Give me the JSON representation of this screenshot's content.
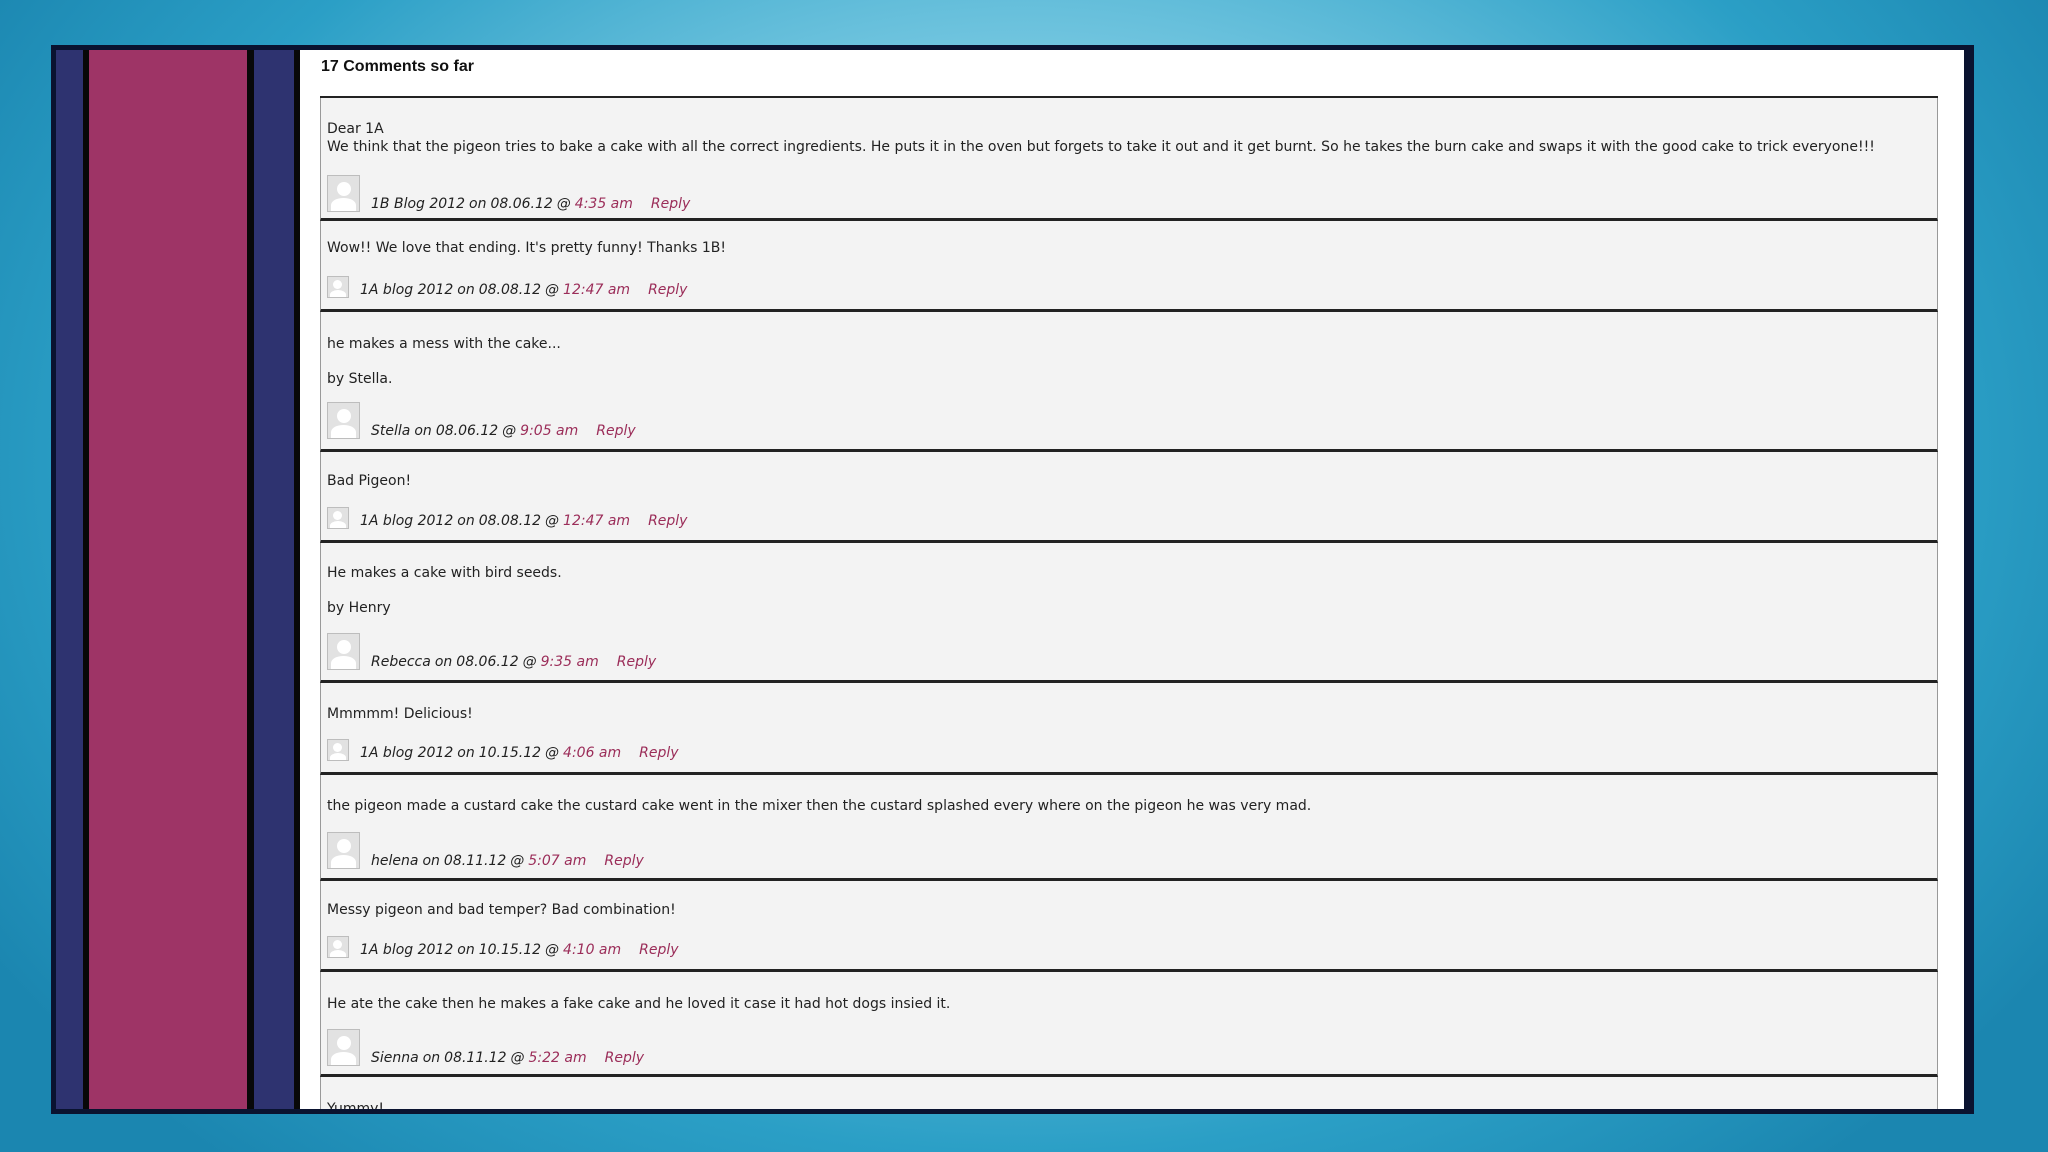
{
  "heading": "17 Comments so far",
  "reply_label": "Reply",
  "comments": [
    {
      "lines": [
        "Dear 1A",
        "We think that the pigeon tries to bake a cake with all the correct ingredients. He puts it in the oven but forgets to take it out and it get burnt. So he takes the burn cake and swaps it with the good cake to trick everyone!!!"
      ],
      "author": "1B Blog 2012",
      "date": "08.06.12",
      "time": "4:35 am"
    },
    {
      "lines": [
        "Wow!! We love that ending. It's pretty funny! Thanks 1B!"
      ],
      "author": "1A blog 2012",
      "date": "08.08.12",
      "time": "12:47 am"
    },
    {
      "lines": [
        "he makes a mess with the cake...",
        "by Stella."
      ],
      "author": "Stella",
      "date": "08.06.12",
      "time": "9:05 am"
    },
    {
      "lines": [
        "Bad Pigeon!"
      ],
      "author": "1A blog 2012",
      "date": "08.08.12",
      "time": "12:47 am"
    },
    {
      "lines": [
        "He makes a cake with bird seeds.",
        "by Henry"
      ],
      "author": "Rebecca",
      "date": "08.06.12",
      "time": "9:35 am"
    },
    {
      "lines": [
        "Mmmmm! Delicious!"
      ],
      "author": "1A blog 2012",
      "date": "10.15.12",
      "time": "4:06 am"
    },
    {
      "lines": [
        "the pigeon made a custard cake the custard cake went in the mixer then the custard splashed every where on the pigeon he was very mad."
      ],
      "author": "helena",
      "date": "08.11.12",
      "time": "5:07 am"
    },
    {
      "lines": [
        "Messy pigeon and bad temper? Bad combination!"
      ],
      "author": "1A blog 2012",
      "date": "10.15.12",
      "time": "4:10 am"
    },
    {
      "lines": [
        "He ate the cake then he makes a fake cake and he loved it case it had hot dogs insied it."
      ],
      "author": "Sienna",
      "date": "08.11.12",
      "time": "5:22 am"
    },
    {
      "lines": [
        "Yummy!"
      ]
    }
  ]
}
